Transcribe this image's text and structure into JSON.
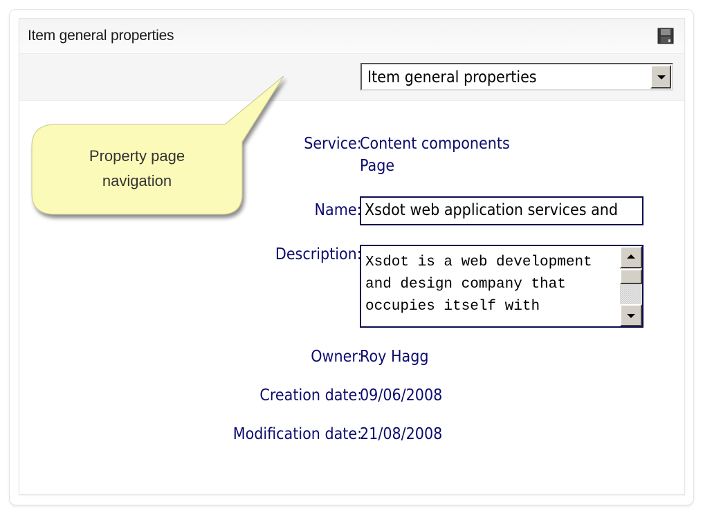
{
  "panel": {
    "title": "Item general properties",
    "save_icon": "floppy-disk-icon"
  },
  "toolbar": {
    "page_select": {
      "selected": "Item general properties",
      "arrow_icon": "chevron-down-icon"
    }
  },
  "fields": {
    "service": {
      "label": "Service:",
      "value_line1": "Content components",
      "value_line2": "Page"
    },
    "name": {
      "label": "Name:",
      "value": "Xsdot web application services and"
    },
    "description": {
      "label": "Description:",
      "value": "Xsdot is a web development and design company that occupies itself with"
    },
    "owner": {
      "label": "Owner:",
      "value": "Roy Hagg"
    },
    "creation_date": {
      "label": "Creation date:",
      "value": "09/06/2008"
    },
    "modification_date": {
      "label": "Modification date:",
      "value": "21/08/2008"
    }
  },
  "callout": {
    "line1": "Property page",
    "line2": "navigation",
    "color": "#fbfab8"
  },
  "colors": {
    "label_text": "#0b0b6e",
    "header_bg": "#f4f4f4",
    "toolbar_bg": "#f5f5f6"
  }
}
